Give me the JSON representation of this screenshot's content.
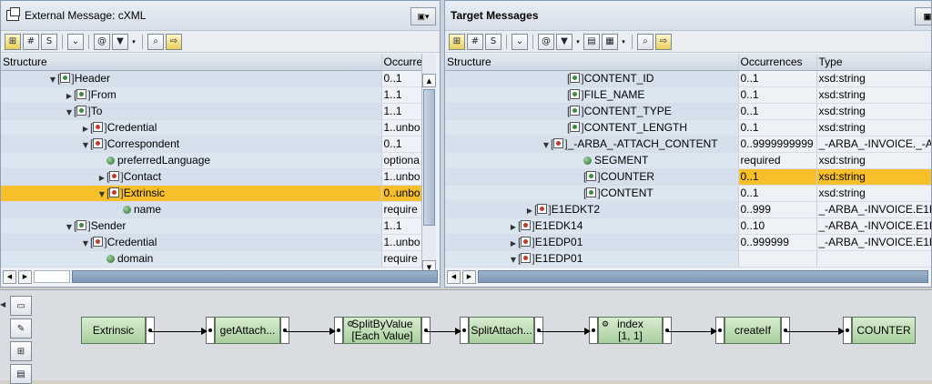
{
  "left_pane": {
    "title": "External Message: cXML",
    "columns": [
      "Structure",
      "Occurre"
    ],
    "rows": [
      {
        "indent": 3,
        "toggle": "down",
        "icon": "node",
        "name": "Header",
        "occ": "0..1",
        "dropdown": true
      },
      {
        "indent": 4,
        "toggle": "right",
        "icon": "node",
        "name": "From",
        "occ": "1..1"
      },
      {
        "indent": 4,
        "toggle": "down",
        "icon": "node",
        "name": "To",
        "occ": "1..1"
      },
      {
        "indent": 5,
        "toggle": "right",
        "icon": "node-red",
        "name": "Credential",
        "occ": "1..unbo"
      },
      {
        "indent": 5,
        "toggle": "down",
        "icon": "node-red",
        "name": "Correspondent",
        "occ": "0..1"
      },
      {
        "indent": 6,
        "toggle": "",
        "icon": "attr",
        "name": "preferredLanguage",
        "occ": "optiona"
      },
      {
        "indent": 6,
        "toggle": "right",
        "icon": "node-red",
        "name": "Contact",
        "occ": "1..unbo"
      },
      {
        "indent": 6,
        "toggle": "down",
        "icon": "node-red",
        "name": "Extrinsic",
        "occ": "0..unbo",
        "selected": true
      },
      {
        "indent": 7,
        "toggle": "",
        "icon": "attr",
        "name": "name",
        "occ": "require"
      },
      {
        "indent": 4,
        "toggle": "down",
        "icon": "node",
        "name": "Sender",
        "occ": "1..1"
      },
      {
        "indent": 5,
        "toggle": "down",
        "icon": "node-red",
        "name": "Credential",
        "occ": "1..unbo"
      },
      {
        "indent": 6,
        "toggle": "",
        "icon": "attr",
        "name": "domain",
        "occ": "require"
      }
    ]
  },
  "right_pane": {
    "title": "Target Messages",
    "columns": [
      "Structure",
      "Occurrences",
      "Type"
    ],
    "rows": [
      {
        "indent": 7,
        "toggle": "",
        "icon": "node",
        "name": "CONTENT_ID",
        "occ": "0..1",
        "type": "xsd:string"
      },
      {
        "indent": 7,
        "toggle": "",
        "icon": "node",
        "name": "FILE_NAME",
        "occ": "0..1",
        "type": "xsd:string"
      },
      {
        "indent": 7,
        "toggle": "",
        "icon": "node",
        "name": "CONTENT_TYPE",
        "occ": "0..1",
        "type": "xsd:string"
      },
      {
        "indent": 7,
        "toggle": "",
        "icon": "node",
        "name": "CONTENT_LENGTH",
        "occ": "0..1",
        "type": "xsd:string"
      },
      {
        "indent": 6,
        "toggle": "down",
        "icon": "node-red",
        "name": "_-ARBA_-ATTACH_CONTENT",
        "occ": "0..9999999999",
        "type": "_-ARBA_-INVOICE._-A"
      },
      {
        "indent": 8,
        "toggle": "",
        "icon": "attr",
        "name": "SEGMENT",
        "occ": "required",
        "type": "xsd:string"
      },
      {
        "indent": 8,
        "toggle": "",
        "icon": "node",
        "name": "COUNTER",
        "occ": "0..1",
        "type": "xsd:string",
        "selected": true
      },
      {
        "indent": 8,
        "toggle": "",
        "icon": "node",
        "name": "CONTENT",
        "occ": "0..1",
        "type": "xsd:string"
      },
      {
        "indent": 5,
        "toggle": "right",
        "icon": "node-red",
        "name": "E1EDKT2",
        "occ": "0..999",
        "type": "_-ARBA_-INVOICE.E1E"
      },
      {
        "indent": 4,
        "toggle": "right",
        "icon": "node-red",
        "name": "E1EDK14",
        "occ": "0..10",
        "type": "_-ARBA_-INVOICE.E1E"
      },
      {
        "indent": 4,
        "toggle": "right",
        "icon": "node-red",
        "name": "E1EDP01",
        "occ": "0..999999",
        "type": "_-ARBA_-INVOICE.E1E"
      },
      {
        "indent": 4,
        "toggle": "down",
        "icon": "node-red",
        "name": "E1EDP01",
        "occ": "",
        "type": ""
      }
    ]
  },
  "mapping": {
    "nodes": [
      {
        "id": "extrinsic",
        "label": "Extrinsic"
      },
      {
        "id": "getattach",
        "label": "getAttach..."
      },
      {
        "id": "splitbyvalue",
        "label": "SplitByValue\n[Each Value]"
      },
      {
        "id": "splitattach",
        "label": "SplitAttach..."
      },
      {
        "id": "index",
        "label": "index\n[1, 1]"
      },
      {
        "id": "createif",
        "label": "createIf"
      },
      {
        "id": "counter",
        "label": "COUNTER"
      }
    ]
  },
  "colors": {
    "selection": "#f7c02a",
    "node_fill": "#bfe0b5"
  }
}
